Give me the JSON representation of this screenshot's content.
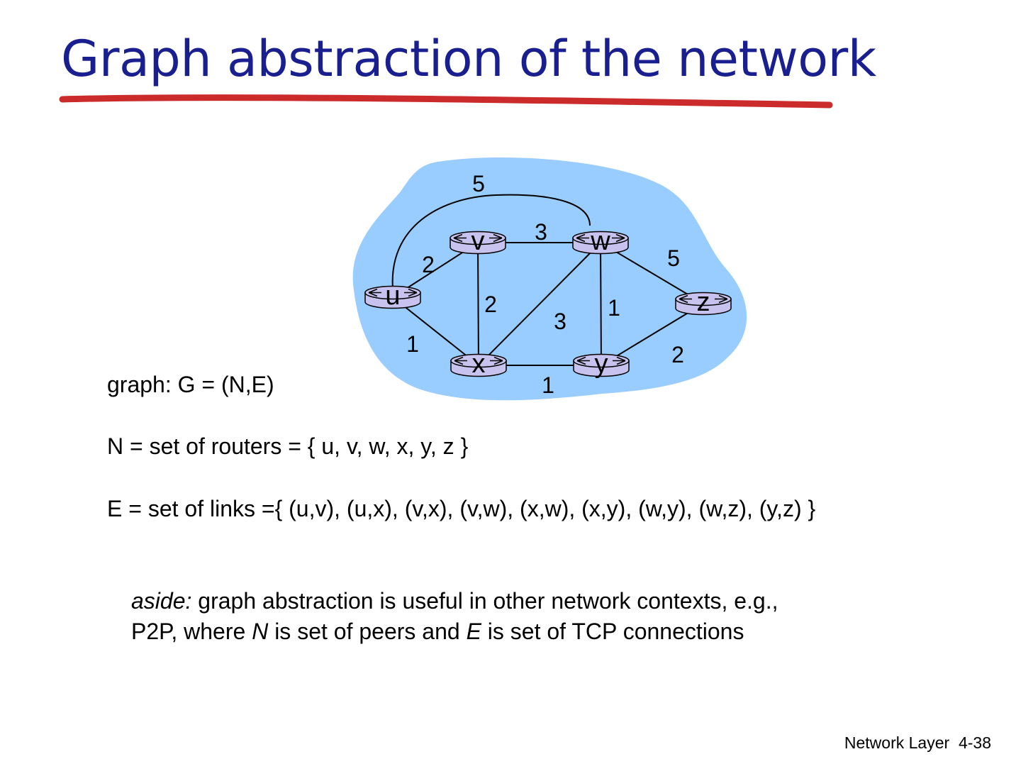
{
  "slide": {
    "title": "Graph abstraction of the network",
    "underline_color": "#cc2b2b",
    "title_color": "#1a1f8f"
  },
  "graph": {
    "cloud_color": "#99ccff",
    "node_color": "#c8c3ee",
    "nodes": [
      {
        "id": "u",
        "label": "u"
      },
      {
        "id": "v",
        "label": "v"
      },
      {
        "id": "w",
        "label": "w"
      },
      {
        "id": "x",
        "label": "x"
      },
      {
        "id": "y",
        "label": "y"
      },
      {
        "id": "z",
        "label": "z"
      }
    ],
    "edges": [
      {
        "from": "u",
        "to": "v",
        "cost": "2"
      },
      {
        "from": "u",
        "to": "x",
        "cost": "1"
      },
      {
        "from": "u",
        "to": "w",
        "cost": "5"
      },
      {
        "from": "v",
        "to": "x",
        "cost": "2"
      },
      {
        "from": "v",
        "to": "w",
        "cost": "3"
      },
      {
        "from": "x",
        "to": "w",
        "cost": "3"
      },
      {
        "from": "x",
        "to": "y",
        "cost": "1"
      },
      {
        "from": "w",
        "to": "y",
        "cost": "1"
      },
      {
        "from": "w",
        "to": "z",
        "cost": "5"
      },
      {
        "from": "y",
        "to": "z",
        "cost": "2"
      }
    ]
  },
  "text": {
    "graph_def": "graph: G = (N,E)",
    "n_def": "N = set of routers = { u, v, w, x, y, z }",
    "e_def": "E = set of links ={ (u,v), (u,x), (v,x), (v,w), (x,w), (x,y), (w,y), (w,z), (y,z) }",
    "aside_label": "aside:",
    "aside_line1": " graph abstraction is useful in other network contexts, e.g.,",
    "aside_line2_a": "P2P, where ",
    "aside_line2_n": "N",
    "aside_line2_b": " is set of peers and ",
    "aside_line2_e": "E",
    "aside_line2_c": " is set of TCP connections"
  },
  "footer": {
    "section": "Network Layer",
    "page": "4-38"
  }
}
